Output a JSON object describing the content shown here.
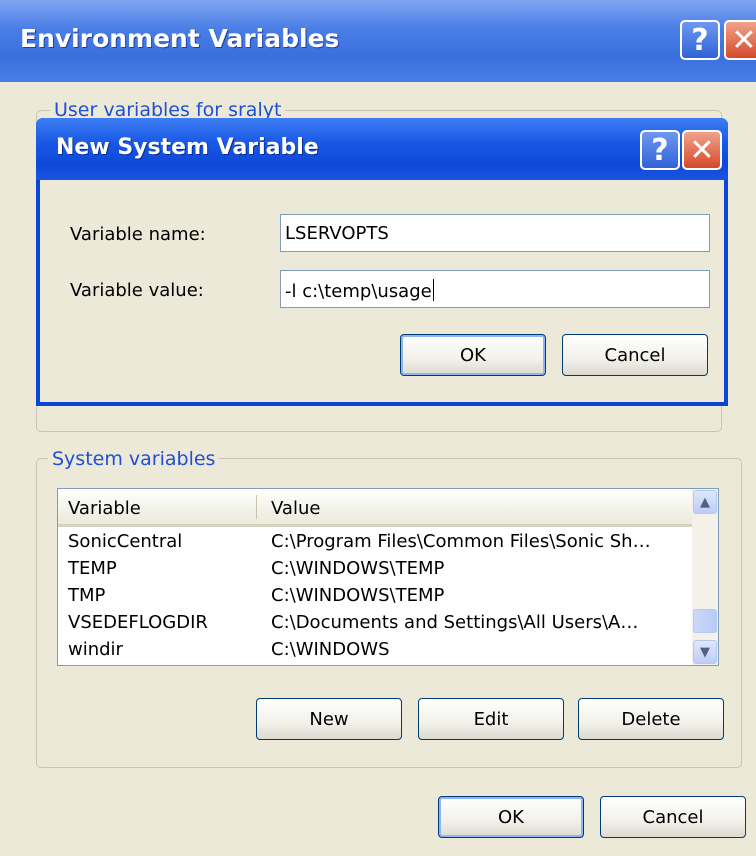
{
  "env_window": {
    "title": "Environment Variables",
    "user_group_label": "User variables for sralyt",
    "system_group_label": "System variables",
    "buttons": {
      "new": "New",
      "edit": "Edit",
      "delete": "Delete",
      "ok": "OK",
      "cancel": "Cancel"
    },
    "table": {
      "columns": [
        "Variable",
        "Value"
      ],
      "rows": [
        {
          "variable": "SonicCentral",
          "value": "C:\\Program Files\\Common Files\\Sonic Sh…"
        },
        {
          "variable": "TEMP",
          "value": "C:\\WINDOWS\\TEMP"
        },
        {
          "variable": "TMP",
          "value": "C:\\WINDOWS\\TEMP"
        },
        {
          "variable": "VSEDEFLOGDIR",
          "value": "C:\\Documents and Settings\\All Users\\A…"
        },
        {
          "variable": "windir",
          "value": "C:\\WINDOWS"
        }
      ]
    }
  },
  "new_var_dialog": {
    "title": "New System Variable",
    "name_label": "Variable name:",
    "value_label": "Variable value:",
    "name_value": "LSERVOPTS",
    "value_value": "-l c:\\temp\\usage",
    "ok_label": "OK",
    "cancel_label": "Cancel"
  },
  "icons": {
    "help": "?",
    "close": "✕",
    "scroll_up": "▲",
    "scroll_down": "▼"
  },
  "colors": {
    "titlebar_blue": "#0a46d6",
    "group_label_blue": "#1f4fd6",
    "dialog_face": "#ece9d8"
  }
}
